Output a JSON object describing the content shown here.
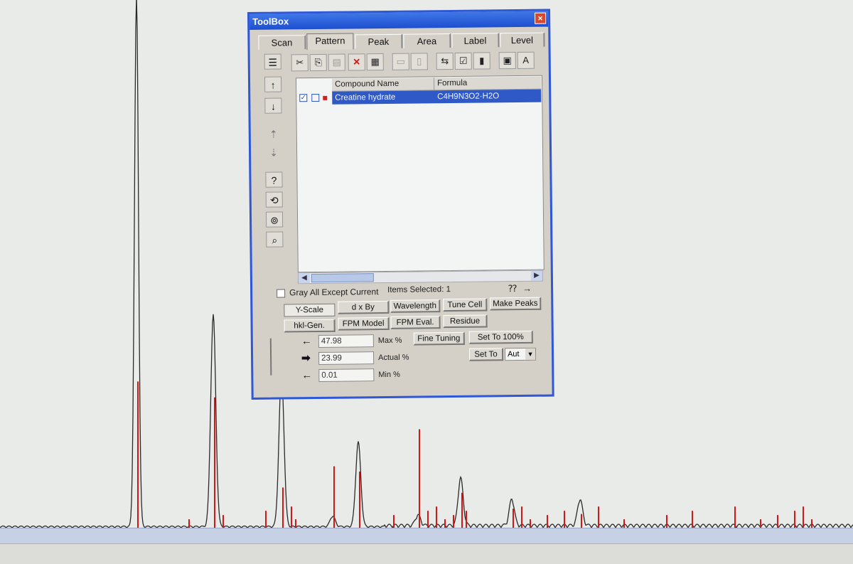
{
  "toolbox": {
    "title": "ToolBox",
    "close": "×",
    "tabs": [
      {
        "label": "Scan",
        "active": false
      },
      {
        "label": "Pattern",
        "active": true
      },
      {
        "label": "Peak",
        "active": false
      },
      {
        "label": "Area",
        "active": false
      },
      {
        "label": "Label",
        "active": false
      },
      {
        "label": "Level",
        "active": false
      }
    ],
    "list": {
      "columns": [
        "Compound Name",
        "Formula"
      ],
      "rows": [
        {
          "checked": true,
          "compound": "Creatine hydrate",
          "formula": "C4H9N3O2·H2O",
          "selected": true
        }
      ]
    },
    "gray_all_except_current": {
      "label": "Gray All Except Current",
      "checked": false
    },
    "items_selected": "Items Selected: 1",
    "buttons_row1": [
      "Y-Scale",
      "d x By",
      "Wavelength",
      "Tune Cell",
      "Make Peaks"
    ],
    "buttons_row2": [
      "hkl-Gen.",
      "FPM Model",
      "FPM Eval.",
      "Residue"
    ],
    "max": {
      "value": "47.98",
      "label": "Max %"
    },
    "actual": {
      "value": "23.99",
      "label": "Actual %"
    },
    "min": {
      "value": "0.01",
      "label": "Min %"
    },
    "fine_tuning": "Fine Tuning",
    "set_to_100": "Set To 100%",
    "set_to": "Set To",
    "set_to_mode": "Aut"
  },
  "chart_data": {
    "type": "line",
    "description_series": [
      {
        "name": "",
        "kind": "measured-scan"
      },
      {
        "name": "",
        "kind": "reference-sticks"
      }
    ],
    "colors": {
      "scan": "#2a2a2a",
      "sticks": "#d01818"
    },
    "relative_peaks": [
      {
        "x": 0.16,
        "scan": 1.0,
        "stick": 0.28
      },
      {
        "x": 0.25,
        "scan": 0.4,
        "stick": 0.25
      },
      {
        "x": 0.33,
        "scan": 0.29,
        "stick": 0.08
      },
      {
        "x": 0.39,
        "scan": 0.02,
        "stick": 0.12
      },
      {
        "x": 0.42,
        "scan": 0.16,
        "stick": 0.11
      },
      {
        "x": 0.49,
        "scan": 0.02,
        "stick": 0.19
      },
      {
        "x": 0.54,
        "scan": 0.09,
        "stick": 0.07
      },
      {
        "x": 0.6,
        "scan": 0.05,
        "stick": 0.04
      },
      {
        "x": 0.68,
        "scan": 0.05,
        "stick": 0.03
      }
    ]
  }
}
